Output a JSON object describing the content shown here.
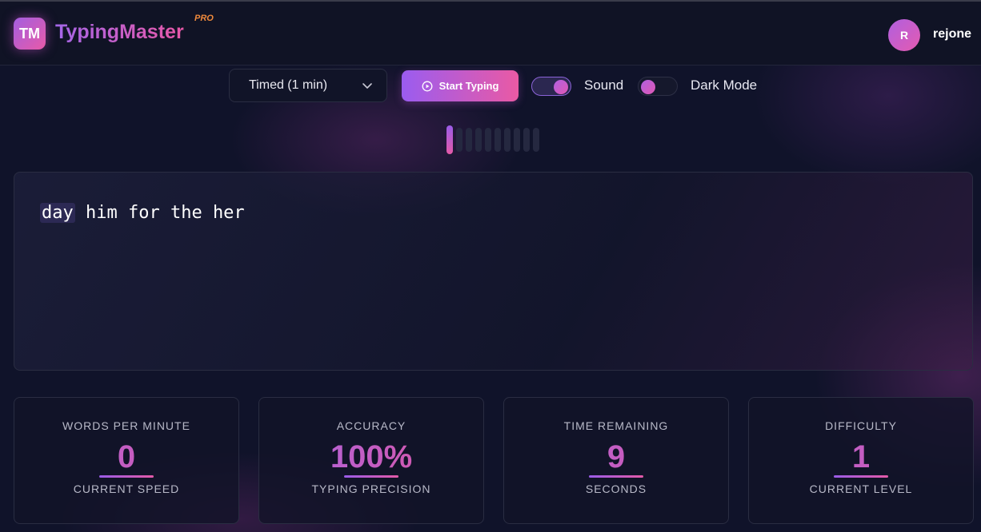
{
  "header": {
    "logo_initials": "TM",
    "brand": "TypingMaster",
    "badge": "PRO",
    "avatar_initial": "R",
    "username": "rejone"
  },
  "controls": {
    "mode": "Timed (1 min)",
    "start_label": "Start Typing",
    "sound_label": "Sound",
    "sound_on": true,
    "dark_mode_label": "Dark Mode",
    "dark_mode_on": false
  },
  "progress": {
    "total_segments": 10,
    "active_segment": 1
  },
  "typing": {
    "current_word": "day",
    "remaining_text": "him for the her"
  },
  "stats": [
    {
      "label": "WORDS PER MINUTE",
      "value": "0",
      "sub": "CURRENT SPEED"
    },
    {
      "label": "ACCURACY",
      "value": "100%",
      "sub": "TYPING PRECISION"
    },
    {
      "label": "TIME REMAINING",
      "value": "9",
      "sub": "SECONDS"
    },
    {
      "label": "DIFFICULTY",
      "value": "1",
      "sub": "CURRENT LEVEL"
    }
  ],
  "colors": {
    "accent_start": "#9a5ce8",
    "accent_end": "#e45aa8",
    "pro_badge": "#f08a3c",
    "background": "#10132a"
  },
  "icons": {
    "mode_dropdown": "chevron-down-icon",
    "start_button": "play-circle-icon"
  }
}
